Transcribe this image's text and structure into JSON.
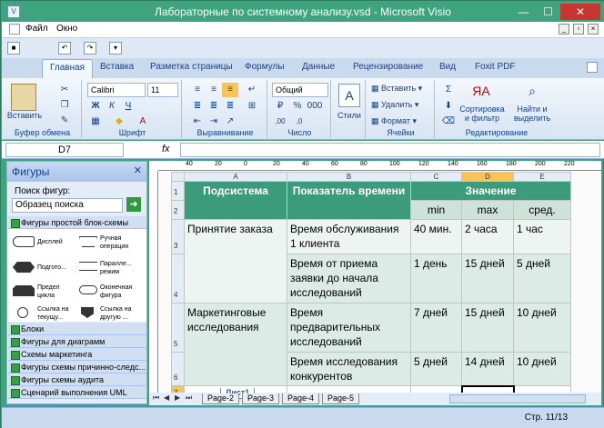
{
  "window": {
    "title": "Лабораторные по системному анализу.vsd - Microsoft Visio",
    "minimize": "—",
    "maximize": "☐",
    "close": "✕"
  },
  "menu": {
    "file": "Файл",
    "window": "Окно"
  },
  "tabs": [
    "Главная",
    "Вставка",
    "Разметка страницы",
    "Формулы",
    "Данные",
    "Рецензирование",
    "Вид",
    "Foxit PDF"
  ],
  "ribbon": {
    "clipboard": {
      "label": "Буфер обмена",
      "paste": "Вставить"
    },
    "font": {
      "label": "Шрифт",
      "name": "Calibri",
      "size": "11",
      "bold": "Ж",
      "italic": "К",
      "underline": "Ч"
    },
    "align": {
      "label": "Выравнивание"
    },
    "number": {
      "label": "Число",
      "format": "Общий"
    },
    "styles": {
      "label": "Стили"
    },
    "cells": {
      "label": "Ячейки",
      "insert": "Вставить",
      "delete": "Удалить",
      "format": "Формат"
    },
    "editing": {
      "label": "Редактирование",
      "sort": "Сортировка и фильтр",
      "find": "Найти и выделить"
    }
  },
  "formula": {
    "cell": "D7",
    "fx": "fx",
    "value": ""
  },
  "shapes_panel": {
    "title": "Фигуры",
    "search_label": "Поиск фигур:",
    "search_placeholder": "Образец поиска",
    "stencil_top": "Фигуры простой блок-схемы",
    "shapes": [
      "Дисплей",
      "Ручная операция",
      "Подгото...",
      "Паралле... режим",
      "Предел цикла",
      "Оконечная фигура",
      "Ссылка на текущу...",
      "Ссылка на другую ..."
    ],
    "stencils": [
      "Блоки",
      "Фигуры для диаграмм",
      "Схемы маркетинга",
      "Фигуры схемы причинно-следс...",
      "Фигуры схемы аудита",
      "Сценарий выполнения UML"
    ]
  },
  "ruler": [
    "40",
    "20",
    "0",
    "20",
    "40",
    "60",
    "80",
    "100",
    "120",
    "140",
    "160",
    "180",
    "200",
    "220",
    "240"
  ],
  "sheet": {
    "col_headers": [
      "A",
      "B",
      "C",
      "D",
      "E"
    ],
    "row_headers": [
      "1",
      "2",
      "3",
      "4",
      "5",
      "6",
      "7"
    ],
    "header": {
      "subsystem": "Подсистема",
      "time": "Показатель времени",
      "value": "Значение",
      "min": "min",
      "max": "max",
      "avg": "сред."
    },
    "rows": [
      {
        "subsystem": "Принятие заказа",
        "metric": "Время обслуживания 1 клиента",
        "min": "40 мин.",
        "max": "2 часа",
        "avg": "1 час"
      },
      {
        "subsystem": "",
        "metric": "Время от приема заявки до начала исследований",
        "min": "1 день",
        "max": "15 дней",
        "avg": "5 дней"
      },
      {
        "subsystem": "Маркетинговые исследования",
        "metric": "Время предварительных исследований",
        "min": "7 дней",
        "max": "15 дней",
        "avg": "10 дней"
      },
      {
        "subsystem": "",
        "metric": "Время исследования конкурентов",
        "min": "5 дней",
        "max": "14 дней",
        "avg": "10 дней"
      }
    ]
  },
  "sheet_tabs": [
    "Лист1"
  ],
  "pages": [
    "Page-2",
    "Page-3",
    "Page-4",
    "Page-5"
  ],
  "status": {
    "page": "Стр. 11/13"
  }
}
